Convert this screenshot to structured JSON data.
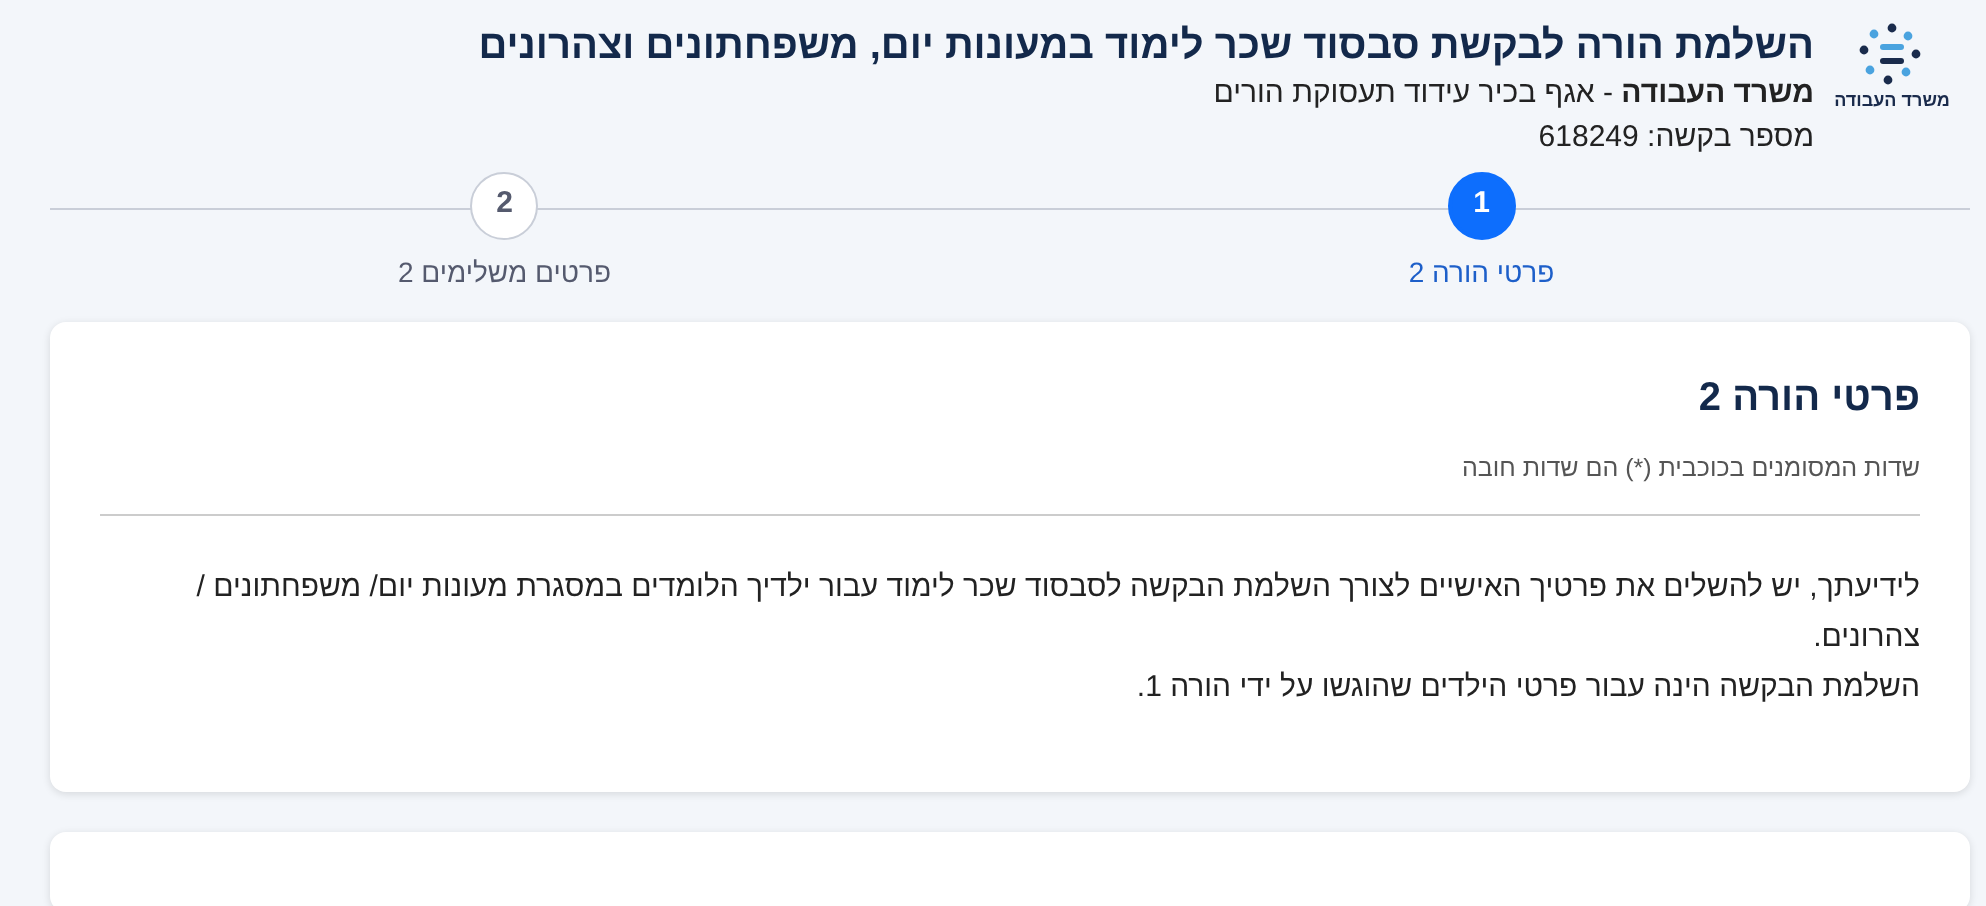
{
  "header": {
    "logo_text": "משרד העבודה",
    "title": "השלמת הורה לבקשת סבסוד שכר לימוד במעונות יום, משפחתונים וצהרונים",
    "ministry": "משרד העבודה",
    "division": " - אגף בכיר עידוד תעסוקת הורים",
    "request_label": "מספר בקשה:",
    "request_number": "618249"
  },
  "steps": [
    {
      "number": "1",
      "label": "פרטי הורה 2",
      "selected": true
    },
    {
      "number": "2",
      "label": "פרטים משלימים 2",
      "selected": false
    }
  ],
  "card": {
    "title": "פרטי הורה 2",
    "required_note": "שדות המסומנים בכוכבית (*) הם שדות חובה",
    "paragraphs": [
      "לידיעתך, יש להשלים את פרטיך האישיים לצורך השלמת הבקשה לסבסוד שכר לימוד עבור ילדיך הלומדים במסגרת מעונות יום/ משפחתונים / צהרונים.",
      "השלמת הבקשה הינה עבור פרטי הילדים שהוגשו על ידי הורה 1."
    ]
  }
}
